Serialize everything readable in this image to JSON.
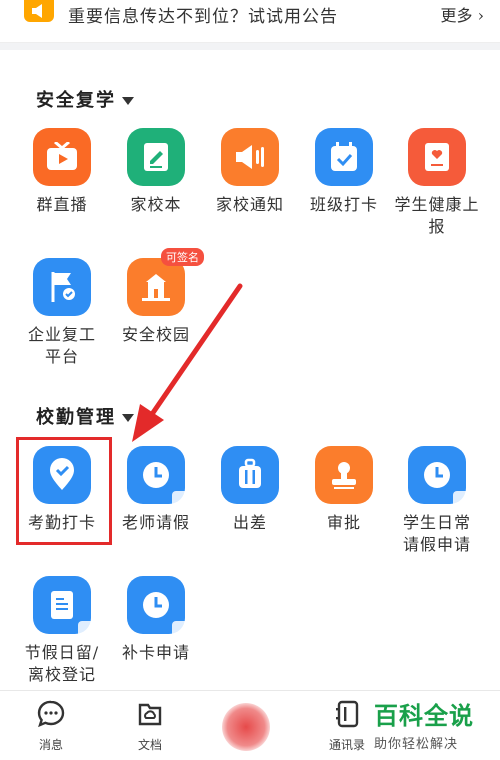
{
  "notice": {
    "text": "重要信息传达不到位？试试用公告",
    "more": "更多"
  },
  "sections": [
    {
      "title": "安全复学",
      "apps": [
        {
          "label": "群直播",
          "icon": "tv-icon"
        },
        {
          "label": "家校本",
          "icon": "notebook-icon"
        },
        {
          "label": "家校通知",
          "icon": "megaphone-icon"
        },
        {
          "label": "班级打卡",
          "icon": "calendar-check-icon"
        },
        {
          "label": "学生健康上报",
          "icon": "health-report-icon"
        },
        {
          "label": "企业复工平台",
          "icon": "flag-icon"
        },
        {
          "label": "安全校园",
          "icon": "school-icon",
          "badge": "可签名"
        }
      ]
    },
    {
      "title": "校勤管理",
      "apps": [
        {
          "label": "考勤打卡",
          "icon": "location-check-icon"
        },
        {
          "label": "老师请假",
          "icon": "clock-icon"
        },
        {
          "label": "出差",
          "icon": "luggage-icon"
        },
        {
          "label": "审批",
          "icon": "stamp-icon"
        },
        {
          "label": "学生日常请假申请",
          "icon": "clock-icon"
        },
        {
          "label": "节假日留/离校登记",
          "icon": "document-icon"
        },
        {
          "label": "补卡申请",
          "icon": "clock-icon"
        }
      ]
    }
  ],
  "bottom_nav": [
    {
      "label": "消息",
      "icon": "chat-icon"
    },
    {
      "label": "文档",
      "icon": "cloud-doc-icon"
    },
    {
      "label": "",
      "icon": "workbench-icon"
    },
    {
      "label": "通讯录",
      "icon": "contacts-icon"
    }
  ],
  "watermark": {
    "title": "百科全说",
    "subtitle": "助你轻松解决"
  }
}
